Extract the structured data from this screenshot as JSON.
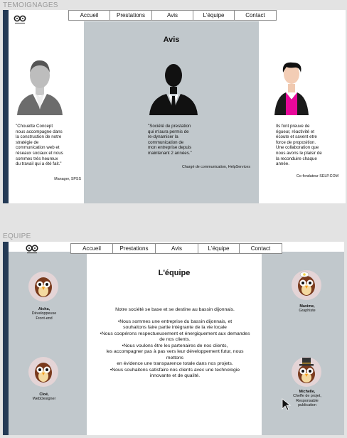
{
  "colors": {
    "page_bg": "#e3e3e3",
    "dark_stripe": "#243a55",
    "gray_panel": "#c1c8cc",
    "accent_magenta": "#e8089a"
  },
  "temoignages": {
    "section_label": "TEMOIGNAGES",
    "nav": [
      "Accueil",
      "Prestations",
      "Avis",
      "L'équipe",
      "Contact"
    ],
    "title": "Avis",
    "testimonials": [
      {
        "avatar_icon": "man-silhouette-gray-icon",
        "lines": [
          "\"Chouette Concept",
          "nous accompagne dans",
          "la construction de notre",
          "stratégie de",
          "communication web et",
          "réseaux sociaux et nous",
          "sommes très heureux",
          "du travail qui a été fait.\""
        ],
        "author": "Manager, SPSS"
      },
      {
        "avatar_icon": "man-silhouette-black-icon",
        "lines": [
          "\"Société de prestation",
          "qui m'aura permis de",
          "re-dynamiser la",
          "communication de",
          "mon entreprise depuis",
          "maintenant 2 années.\""
        ],
        "author": "Chargé de communication, HelpServices"
      },
      {
        "avatar_icon": "man-portrait-magenta-shirt-icon",
        "lines": [
          "Ils font preuve de",
          "rigueur, réactivité et",
          "écoute et savent etre",
          "force de proposition.",
          "Une collaboration que",
          "nous avons le plaisir de",
          "la reconduire chaque",
          "année."
        ],
        "author": "Co-fondateur SELP.COM"
      }
    ]
  },
  "equipe": {
    "section_label": "EQUIPE",
    "nav": [
      "Accueil",
      "Prestations",
      "Avis",
      "L'équipe",
      "Contact"
    ],
    "title": "L'équipe",
    "paragraphs": [
      [
        "Notre société se base et se destine au bassin dijonnais."
      ],
      [
        "•Nous sommes une entreprise du bassin dijonnais, et",
        "souhaitons faire partie intégrante de la vie locale",
        "•Nous coopérons respectueusement et énergiquement aux demandes",
        "de nos clients.",
        "•Nous voulons être les partenaires de nos clients,",
        "les accompagner pas à pas vers leur développement futur, nous",
        "mettons",
        "en évidence une transparence totale dans nos projets.",
        "•Nous souhaitons satisfaire nos clients avec une technologie",
        "innovante et de qualité."
      ]
    ],
    "members": [
      {
        "name": "Aicha,",
        "role": [
          "Développeuse",
          "Front-end"
        ],
        "icon": "owl-avatar-icon"
      },
      {
        "name": "Cloé,",
        "role": [
          "WebDesigner"
        ],
        "icon": "owl-avatar-icon"
      },
      {
        "name": "Maxime,",
        "role": [
          "Graphiste"
        ],
        "icon": "owl-avatar-idea-icon"
      },
      {
        "name": "Michelle,",
        "role": [
          "Cheffe de projet,",
          "Responsable",
          "publication"
        ],
        "icon": "owl-avatar-tophat-icon"
      }
    ]
  }
}
